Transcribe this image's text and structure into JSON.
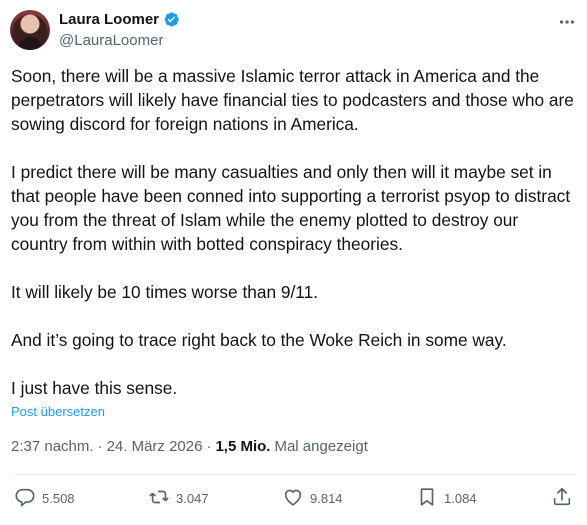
{
  "author": {
    "display_name": "Laura Loomer",
    "handle": "@LauraLoomer"
  },
  "tweet": {
    "paragraphs": [
      "Soon, there will be a massive Islamic terror attack in America and the perpetrators will likely have financial ties to podcasters and those who are sowing discord for foreign nations in America.",
      "I predict there will be many casualties and only then will it maybe set in that people have been conned into supporting a terrorist psyop to distract you from the threat of Islam while the enemy plotted to destroy our country from within with botted conspiracy theories.",
      "It will likely be 10 times worse than 9/11.",
      "And it’s going to trace right back to the Woke Reich in some way.",
      "I just have this sense."
    ],
    "translate_label": "Post übersetzen"
  },
  "meta": {
    "time": "2:37 nachm.",
    "separator": "·",
    "date": "24. März 2026",
    "views_count": "1,5 Mio.",
    "views_label": "Mal angezeigt"
  },
  "actions": {
    "replies": "5.508",
    "reposts": "3.047",
    "likes": "9.814",
    "bookmarks": "1.084"
  },
  "colors": {
    "accent": "#1d9bf0",
    "text": "#0f1419",
    "secondary": "#536471"
  },
  "icons": [
    "verified-badge-icon",
    "more-icon",
    "reply-icon",
    "repost-icon",
    "like-icon",
    "bookmark-icon",
    "share-icon"
  ]
}
